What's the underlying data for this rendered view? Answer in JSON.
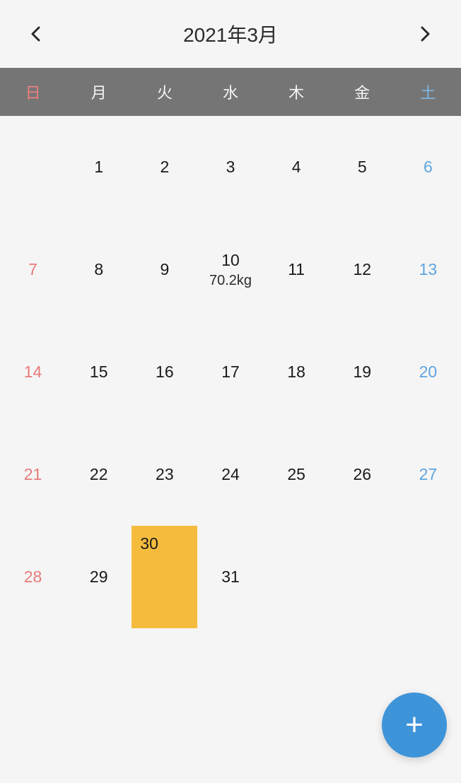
{
  "header": {
    "title": "2021年3月",
    "prev_icon": "‹",
    "next_icon": "›"
  },
  "weekdays": [
    "日",
    "月",
    "火",
    "水",
    "木",
    "金",
    "土"
  ],
  "days": [
    {
      "num": "",
      "type": "empty"
    },
    {
      "num": "1",
      "type": "normal"
    },
    {
      "num": "2",
      "type": "normal"
    },
    {
      "num": "3",
      "type": "normal"
    },
    {
      "num": "4",
      "type": "normal"
    },
    {
      "num": "5",
      "type": "normal"
    },
    {
      "num": "6",
      "type": "saturday"
    },
    {
      "num": "7",
      "type": "sunday"
    },
    {
      "num": "8",
      "type": "normal"
    },
    {
      "num": "9",
      "type": "normal"
    },
    {
      "num": "10",
      "type": "normal",
      "note": "70.2kg"
    },
    {
      "num": "11",
      "type": "normal"
    },
    {
      "num": "12",
      "type": "normal"
    },
    {
      "num": "13",
      "type": "saturday"
    },
    {
      "num": "14",
      "type": "sunday"
    },
    {
      "num": "15",
      "type": "normal"
    },
    {
      "num": "16",
      "type": "normal"
    },
    {
      "num": "17",
      "type": "normal"
    },
    {
      "num": "18",
      "type": "normal"
    },
    {
      "num": "19",
      "type": "normal"
    },
    {
      "num": "20",
      "type": "saturday"
    },
    {
      "num": "21",
      "type": "sunday"
    },
    {
      "num": "22",
      "type": "normal"
    },
    {
      "num": "23",
      "type": "normal"
    },
    {
      "num": "24",
      "type": "normal"
    },
    {
      "num": "25",
      "type": "normal"
    },
    {
      "num": "26",
      "type": "normal"
    },
    {
      "num": "27",
      "type": "saturday"
    },
    {
      "num": "28",
      "type": "sunday"
    },
    {
      "num": "29",
      "type": "normal"
    },
    {
      "num": "30",
      "type": "normal",
      "selected": true
    },
    {
      "num": "31",
      "type": "normal"
    },
    {
      "num": "",
      "type": "empty"
    },
    {
      "num": "",
      "type": "empty"
    },
    {
      "num": "",
      "type": "empty"
    }
  ],
  "fab": {
    "icon": "+"
  }
}
